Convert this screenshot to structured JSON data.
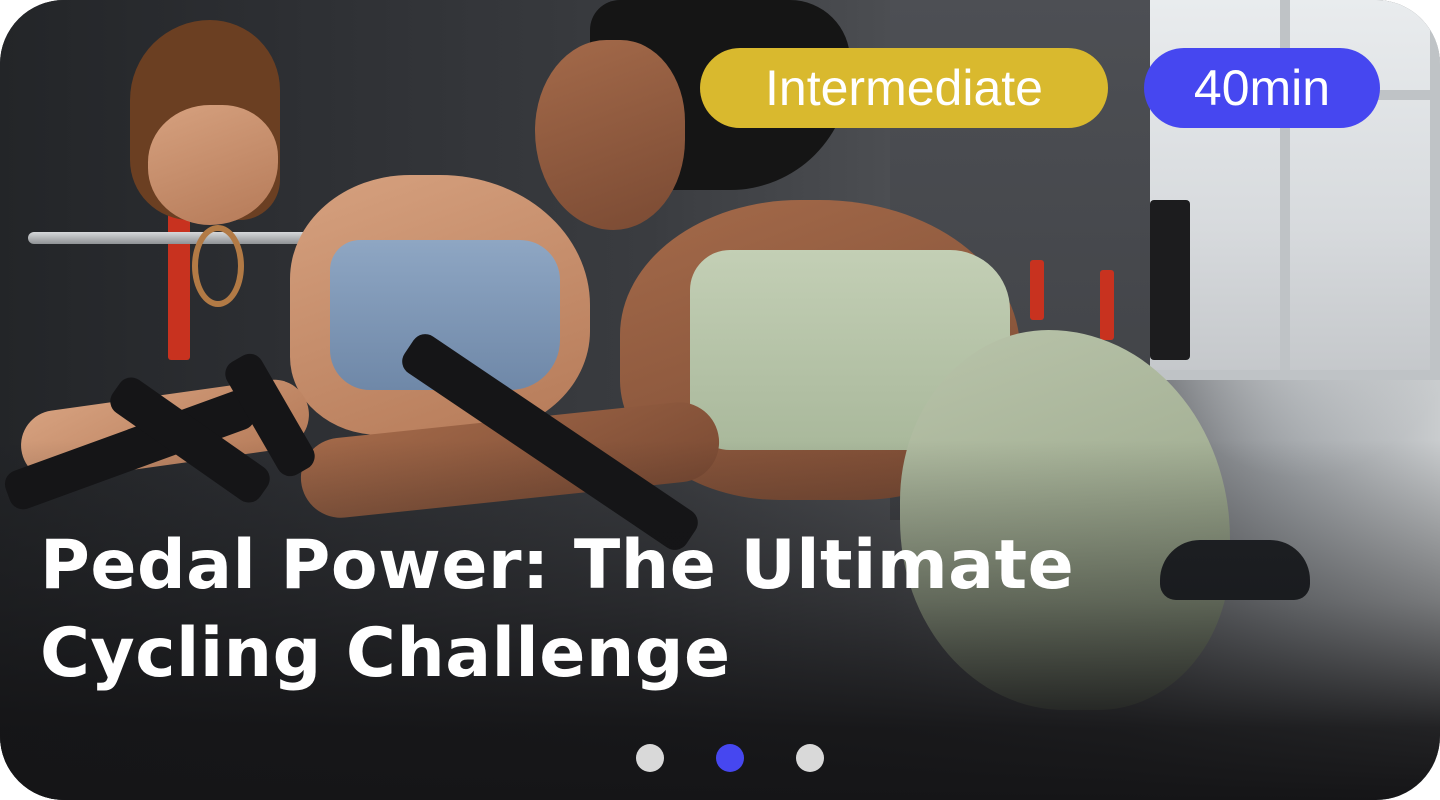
{
  "card": {
    "level_badge": "Intermediate",
    "duration_badge": "40min",
    "title": "Pedal Power: The Ultimate Cycling Challenge",
    "image_icon": "photo-icon"
  },
  "carousel": {
    "count": 3,
    "active_index": 1
  },
  "colors": {
    "level_badge": "#d9b92e",
    "duration_badge": "#4647f0",
    "dot_active": "#4647f0",
    "dot_inactive": "#d9d9d9",
    "title_text": "#ffffff"
  }
}
